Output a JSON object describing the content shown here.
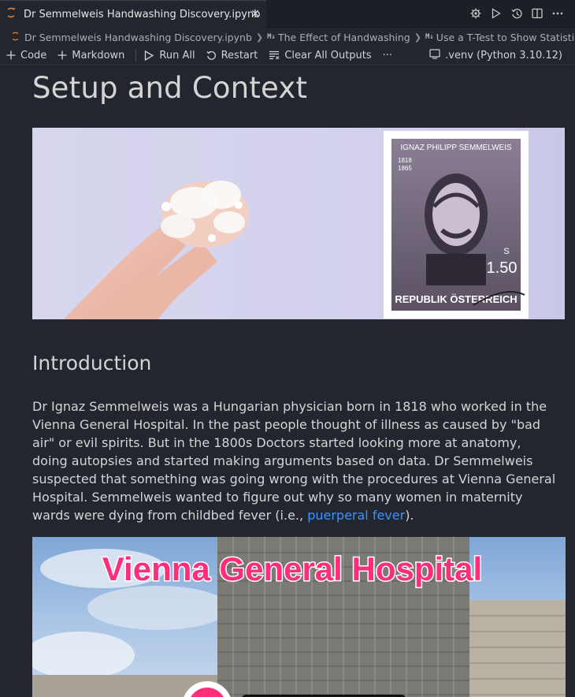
{
  "tab": {
    "icon": "notebook-icon",
    "title": "Dr Semmelweis Handwashing Discovery.ipynb",
    "close_symbol": "✕"
  },
  "tab_actions": [
    "settings-gear-icon",
    "run-icon",
    "history-icon",
    "split-editor-icon",
    "more-icon"
  ],
  "breadcrumb": {
    "file": "Dr Semmelweis Handwashing Discovery.ipynb",
    "section": "The Effect of Handwashing",
    "subsection": "Use a T-Test to Show Statistica",
    "md_tag": "M↓"
  },
  "toolbar": {
    "code_label": "Code",
    "markdown_label": "Markdown",
    "run_all_label": "Run All",
    "restart_label": "Restart",
    "clear_outputs_label": "Clear All Outputs",
    "more_label": "···",
    "kernel_label": ".venv (Python 3.10.12)"
  },
  "cell": {
    "heading": "Setup and Context",
    "stamp_name": "IGNAZ PHILIPP SEMMELWEIS",
    "stamp_years": [
      "1818",
      "1865"
    ],
    "stamp_value": "1.50",
    "stamp_currency": "S",
    "stamp_country": "REPUBLIK ÖSTERREICH",
    "intro_heading": "Introduction",
    "intro_text": "Dr Ignaz Semmelweis was a Hungarian physician born in 1818 who worked in the Vienna General Hospital. In the past people thought of illness as caused by \"bad air\" or evil spirits. But in the 1800s Doctors started looking more at anatomy, doing autopsies and started making arguments based on data. Dr Semmelweis suspected that something was going wrong with the procedures at Vienna General Hospital. Semmelweis wanted to figure out why so many women in maternity wards were dying from childbed fever (i.e., ",
    "intro_link": "puerperal fever",
    "intro_end": ").",
    "hospital_banner": "Vienna General Hospital"
  },
  "colors": {
    "background": "#23262e",
    "link": "#3794ff",
    "banner_text": "#ff2d7a",
    "notebook_icon": "#e37933"
  }
}
